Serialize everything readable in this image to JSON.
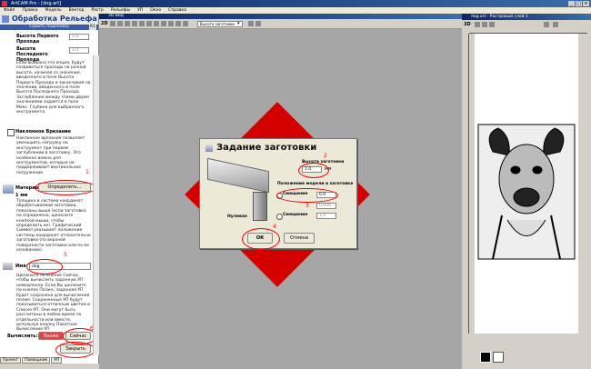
{
  "app": {
    "title": "ArtCAM Pro - [dog.art]"
  },
  "menu": [
    "Файл",
    "Правка",
    "Модель",
    "Вектор",
    "Растр",
    "Рельефы",
    "УП",
    "Окно",
    "Справка"
  ],
  "left_panel": {
    "title": "Обработка Рельефа",
    "sub_header": "Скрыть подсказку",
    "sub_header_badge": "K1",
    "first_height_label": "Высота Первого Прохода",
    "first_height_value": "1.0",
    "last_height_label": "Высота Последнего Прохода",
    "last_height_value": "1.0",
    "help_text_1": "Если выбрана эта опция, будут создаваться проходы на разной высоте, начиная со значения, введенного в поле Высота Первого Прохода и заканчивая на значении, введенного в поле Высота Последнего Прохода. Заглубление между этими двумя значениями задается в поле Макс. Глубина для выбранного инструмента",
    "incline_label": "Наклонное Врезание",
    "help_text_2": "Наклонное врезание позволяет уменьшить нагрузку на инструмент при первом заглублении в заготовку. Это особенно важно для инструментов, которые не поддерживают вертикальное погружение.",
    "material_label": "Материал",
    "define_button": "Определить...",
    "mm_label": "1 мм",
    "help_text_3": "Толщина и система координат обрабатываемой заготовки, показаны выше (если заготовка не определена, щелкните кнопкой мыши, чтобы определить ее). Графический Символ указывает положение системы координат относительно заготовки (по верхней поверхности заготовки или по ее основанию).",
    "name_label": "Имя:",
    "name_value": "dog",
    "help_text_4": "Щелкните по кнопке Сейчас, чтобы вычислить заданную УП немедленно. Если Вы щелкните по кнопке Позже, заданная УП будет сохранена для вычисления позже. Сохраненные УП будут показываться отличным цветом в Списке УП. Они могут быть рассчитаны в любое время по отдельности или вместе, используя кнопку Пакетное Вычисление УП",
    "calc_label": "Вычислить:",
    "later_button": "Позже",
    "now_button": "Сейчас",
    "close_button": "Закрыть",
    "tabs": [
      "Проект",
      "Помощник",
      "УП"
    ]
  },
  "center": {
    "window_title": "3D Вид",
    "view_dropdown": "Высота заготовки"
  },
  "dialog": {
    "title": "Задание заготовки",
    "thickness_label": "Высота заготовки",
    "thickness_value": "1.0",
    "thickness_unit": "мм",
    "position_label": "Положение модели в заготовке",
    "offset_label": "Смещение",
    "offset_value_1": "0.0",
    "zero_label": "Нулевая",
    "zero_value": "0.000",
    "offset_label_2": "Смещение",
    "offset_value_2": "1.0",
    "ok_button": "ОК",
    "cancel_button": "Отмена"
  },
  "right": {
    "window_title": "dog.art - Растровый слой 1"
  },
  "annotations": [
    "1",
    "2",
    "3",
    "4",
    "5",
    "6"
  ],
  "colors": {
    "accent": "#3a5ca8",
    "highlight": "#e00000",
    "diamond": "#d40000"
  }
}
